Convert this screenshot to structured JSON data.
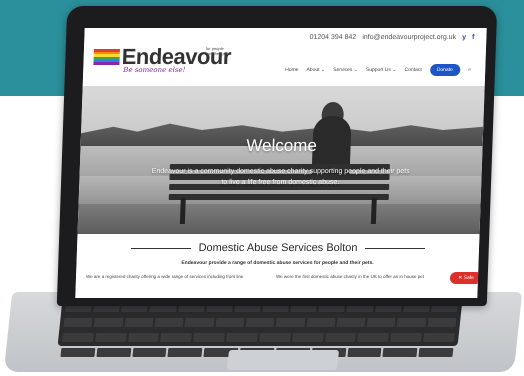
{
  "site": {
    "contact": {
      "phone": "01204 394 842",
      "email": "info@endeavourproject.org.uk",
      "social": [
        "y",
        "f"
      ]
    },
    "logo": {
      "name": "Endeavour",
      "tagline": "for people and their pets",
      "script": "Be someone else!"
    },
    "nav": {
      "items": [
        "Home",
        "About ⌄",
        "Services ⌄",
        "Support Us ⌄",
        "Contact"
      ],
      "donate_label": "Donate",
      "search_icon": "search-icon"
    },
    "hero": {
      "title": "Welcome",
      "subtitle": "Endeavour is a community domestic abuse charity supporting people and their pets to live a life free from domestic abuse."
    },
    "content": {
      "section_title": "Domestic Abuse Services Bolton",
      "section_sub": "Endeavour provide a range of domestic abuse services for people and their pets.",
      "col_left": "We are a registered charity offering a wide range of services including front line",
      "col_right": "We were the first domestic abuse charity in the UK to offer an in house pet",
      "safe_label": "✕ Safe"
    }
  },
  "colors": {
    "band": "#2a8f9a",
    "donate": "#1e56c6",
    "safe": "#d9302c"
  }
}
